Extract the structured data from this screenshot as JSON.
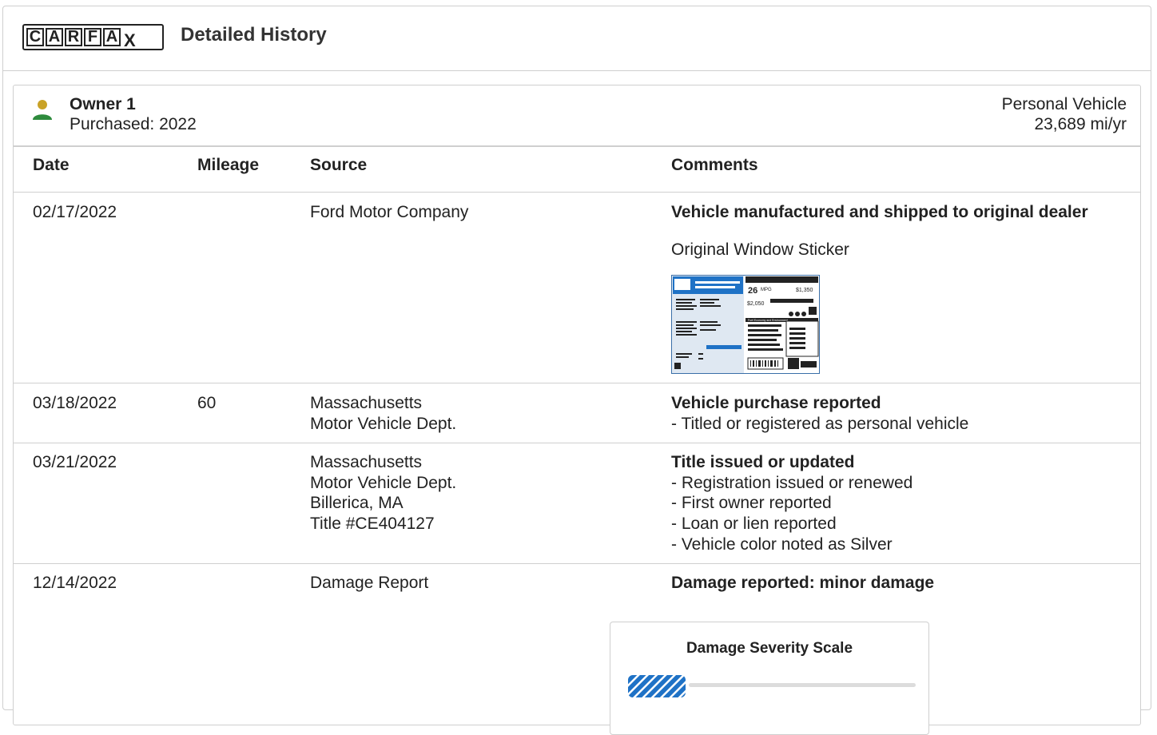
{
  "header": {
    "logo_letters": [
      "C",
      "A",
      "R",
      "F",
      "A",
      "X"
    ],
    "title": "Detailed History"
  },
  "owner": {
    "name": "Owner 1",
    "purchased": "Purchased: 2022",
    "vehicle_type": "Personal Vehicle",
    "mileage_per_year": "23,689 mi/yr"
  },
  "table": {
    "columns": [
      "Date",
      "Mileage",
      "Source",
      "Comments"
    ],
    "rows": [
      {
        "date": "02/17/2022",
        "mileage": "",
        "source": [
          "Ford Motor Company"
        ],
        "comment_title": "Vehicle manufactured and shipped to original dealer",
        "comment_sub": "Original Window Sticker",
        "comment_items": []
      },
      {
        "date": "03/18/2022",
        "mileage": "60",
        "source": [
          "Massachusetts",
          "Motor Vehicle Dept."
        ],
        "comment_title": "Vehicle purchase reported",
        "comment_items": [
          "- Titled or registered as personal vehicle"
        ]
      },
      {
        "date": "03/21/2022",
        "mileage": "",
        "source": [
          "Massachusetts",
          "Motor Vehicle Dept.",
          "Billerica, MA",
          "Title #CE404127"
        ],
        "comment_title": "Title issued or updated",
        "comment_items": [
          "- Registration issued or renewed",
          "- First owner reported",
          "- Loan or lien reported",
          "- Vehicle color noted as Silver"
        ]
      },
      {
        "date": "12/14/2022",
        "mileage": "",
        "source": [
          "Damage Report"
        ],
        "comment_title": "Damage reported: minor damage",
        "comment_items": []
      }
    ]
  },
  "damage_scale": {
    "title": "Damage Severity Scale",
    "severity_level": 0.2
  },
  "sticker": {
    "mpg": "26",
    "mpg_unit": "MPG",
    "price_top": "$1,350",
    "price_low": "$2,050",
    "label": "Fuel Economy and Environment"
  },
  "colors": {
    "accent_blue": "#1f72c6",
    "owner_icon_head": "#c9a227",
    "owner_icon_body": "#2e8b3d",
    "border": "#cfcfcf"
  }
}
